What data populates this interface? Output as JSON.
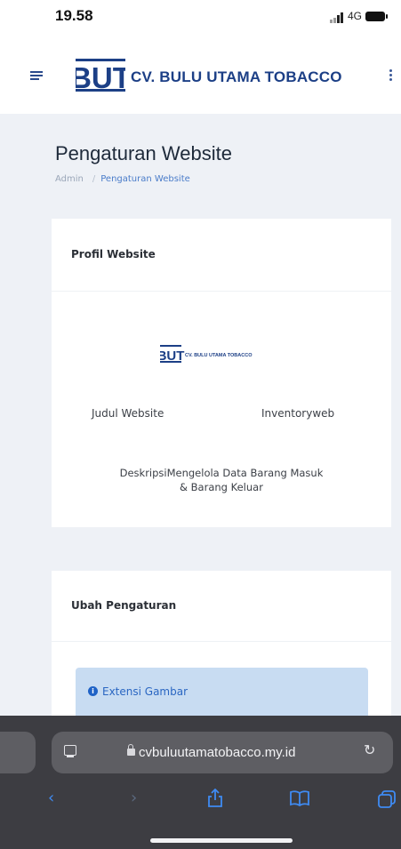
{
  "status_bar": {
    "time": "19.58",
    "network": "4G"
  },
  "header": {
    "logo_text": "BUT",
    "brand": "CV. BULU UTAMA TOBACCO"
  },
  "page": {
    "title": "Pengaturan Website",
    "breadcrumb": [
      "Admin",
      "Pengaturan Website"
    ]
  },
  "profile_card": {
    "title": "Profil Website",
    "logo_text": "BUT",
    "logo_caption": "CV. BULU UTAMA TOBACCO",
    "judul_label": "Judul Website",
    "judul_value": "Inventoryweb",
    "deskripsi_line1": "DeskripsiMengelola Data Barang Masuk",
    "deskripsi_line2": "& Barang Keluar"
  },
  "settings_card": {
    "title": "Ubah Pengaturan",
    "alert_text": "Extensi Gambar"
  },
  "browser": {
    "url": "cvbuluutamatobacco.my.id"
  },
  "colors": {
    "brand": "#1c3f86",
    "link": "#4a7cc9",
    "alert_bg": "#c8dcf2",
    "toolbar_accent": "#3f8bf3"
  }
}
